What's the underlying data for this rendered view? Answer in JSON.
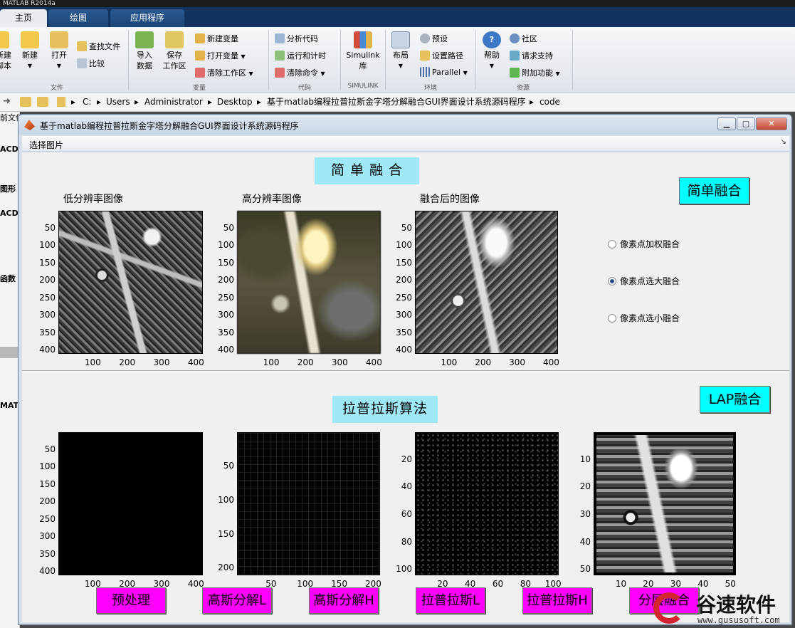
{
  "app": {
    "window_title": "MATLAB R2014a",
    "tabs": [
      "主页",
      "绘图",
      "应用程序"
    ]
  },
  "ribbon": {
    "file_group": {
      "label": "文件",
      "new_script": "新建\n脚本",
      "new": "新建",
      "open": "打开",
      "find_files": "查找文件",
      "compare": "比较"
    },
    "variable_group": {
      "label": "变量",
      "import_data": "导入\n数据",
      "save_workspace": "保存\n工作区",
      "new_variable": "新建变量",
      "open_variable": "打开变量",
      "clear_workspace": "清除工作区"
    },
    "code_group": {
      "label": "代码",
      "analyze_code": "分析代码",
      "run_and_time": "运行和计时",
      "clear_commands": "清除命令"
    },
    "simulink_group": {
      "label": "SIMULINK",
      "simulink": "Simulink\n库"
    },
    "environment_group": {
      "label": "环境",
      "layout": "布局",
      "preferences": "预设",
      "set_path": "设置路径",
      "parallel": "Parallel"
    },
    "resources_group": {
      "label": "资源",
      "help": "帮助",
      "community": "社区",
      "request_support": "请求支持",
      "add_ons": "附加功能"
    }
  },
  "address": {
    "path": [
      "C:",
      "Users",
      "Administrator",
      "Desktop",
      "基于matlab编程拉普拉斯金字塔分解融合GUI界面设计系统源码程序",
      "code"
    ]
  },
  "sidebar": {
    "items": [
      "前文件",
      "ACD",
      "图形",
      "ACD",
      "函数",
      "MAT"
    ]
  },
  "figure": {
    "title": "基于matlab编程拉普拉斯金字塔分解融合GUI界面设计系统源码程序",
    "menu": "选择图片",
    "simple_section": {
      "heading": "简  单  融  合",
      "button": "简单融合",
      "axes": [
        {
          "title": "低分辨率图像",
          "yticks": [
            "50",
            "100",
            "150",
            "200",
            "250",
            "300",
            "350",
            "400"
          ],
          "xticks": [
            "100",
            "200",
            "300",
            "400"
          ]
        },
        {
          "title": "高分辨率图像",
          "yticks": [
            "50",
            "100",
            "150",
            "200",
            "250",
            "300",
            "350",
            "400"
          ],
          "xticks": [
            "100",
            "200",
            "300",
            "400"
          ]
        },
        {
          "title": "融合后的图像",
          "yticks": [
            "50",
            "100",
            "150",
            "200",
            "250",
            "300",
            "350",
            "400"
          ],
          "xticks": [
            "100",
            "200",
            "300",
            "400"
          ]
        }
      ],
      "options": [
        {
          "label": "像素点加权融合",
          "selected": false
        },
        {
          "label": "像素点选大融合",
          "selected": true
        },
        {
          "label": "像素点选小融合",
          "selected": false
        }
      ]
    },
    "lap_section": {
      "heading": "拉普拉斯算法",
      "button": "LAP融合",
      "axes": [
        {
          "yticks": [
            "50",
            "100",
            "150",
            "200",
            "250",
            "300",
            "350",
            "400"
          ],
          "xticks": [
            "100",
            "200",
            "300",
            "400"
          ]
        },
        {
          "yticks": [
            "50",
            "100",
            "150",
            "200"
          ],
          "xticks": [
            "50",
            "100",
            "150",
            "200"
          ]
        },
        {
          "yticks": [
            "20",
            "40",
            "60",
            "80",
            "100"
          ],
          "xticks": [
            "20",
            "40",
            "60",
            "80",
            "100"
          ]
        },
        {
          "yticks": [
            "10",
            "20",
            "30",
            "40",
            "50"
          ],
          "xticks": [
            "10",
            "20",
            "30",
            "40",
            "50"
          ]
        }
      ],
      "buttons": [
        "预处理",
        "高斯分解L",
        "高斯分解H",
        "拉普拉斯L",
        "拉普拉斯H",
        "分层融合"
      ]
    }
  },
  "watermark": {
    "text": "谷速软件",
    "url": "www.gususoft.com"
  },
  "colors": {
    "heading_bg": "#9fe8f7",
    "cyan_button": "#00ffff",
    "magenta_button": "#ff00ff",
    "tab_bar": "#10345f"
  }
}
